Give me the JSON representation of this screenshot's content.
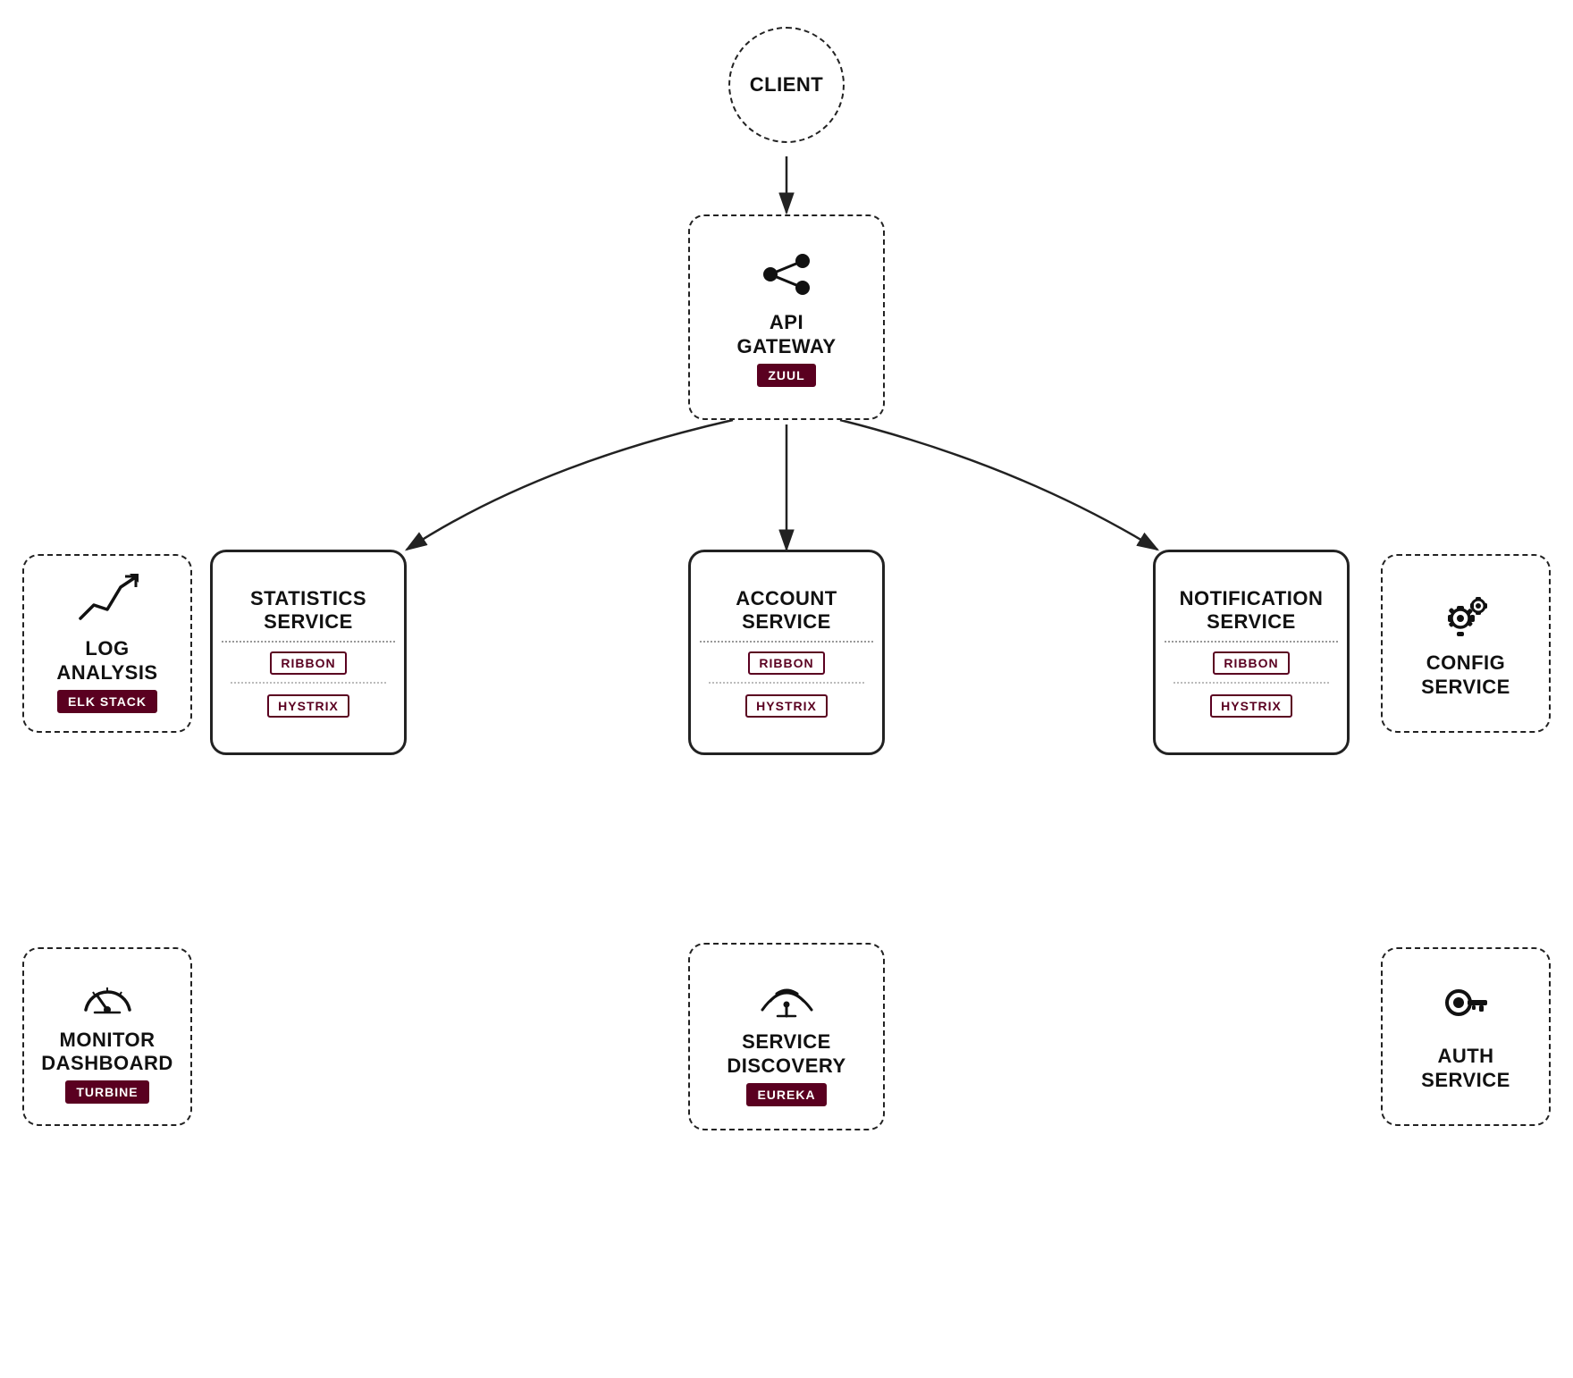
{
  "nodes": {
    "client": {
      "label": "CLIENT"
    },
    "api_gateway": {
      "label": "API\nGATEWAY",
      "badge": "ZUUL"
    },
    "log_analysis": {
      "label": "LOG\nANALYSIS",
      "badge": "ELK STACK"
    },
    "statistics": {
      "label": "STATISTICS\nSERVICE",
      "ribbon": "RIBBON",
      "hystrix": "HYSTRIX"
    },
    "account": {
      "label": "ACCOUNT\nSERVICE",
      "ribbon": "RIBBON",
      "hystrix": "HYSTRIX"
    },
    "notification": {
      "label": "NOTIFICATION\nSERVICE",
      "ribbon": "RIBBON",
      "hystrix": "HYSTRIX"
    },
    "config": {
      "label": "CONFIG\nSERVICE"
    },
    "monitor": {
      "label": "MONITOR\nDASHBOARD",
      "badge": "TURBINE"
    },
    "service_discovery": {
      "label": "SERVICE\nDISCOVERY",
      "badge": "EUREKA"
    },
    "auth": {
      "label": "AUTH\nSERVICE"
    }
  },
  "colors": {
    "badge_bg": "#5a0020",
    "border": "#222",
    "text": "#111"
  }
}
